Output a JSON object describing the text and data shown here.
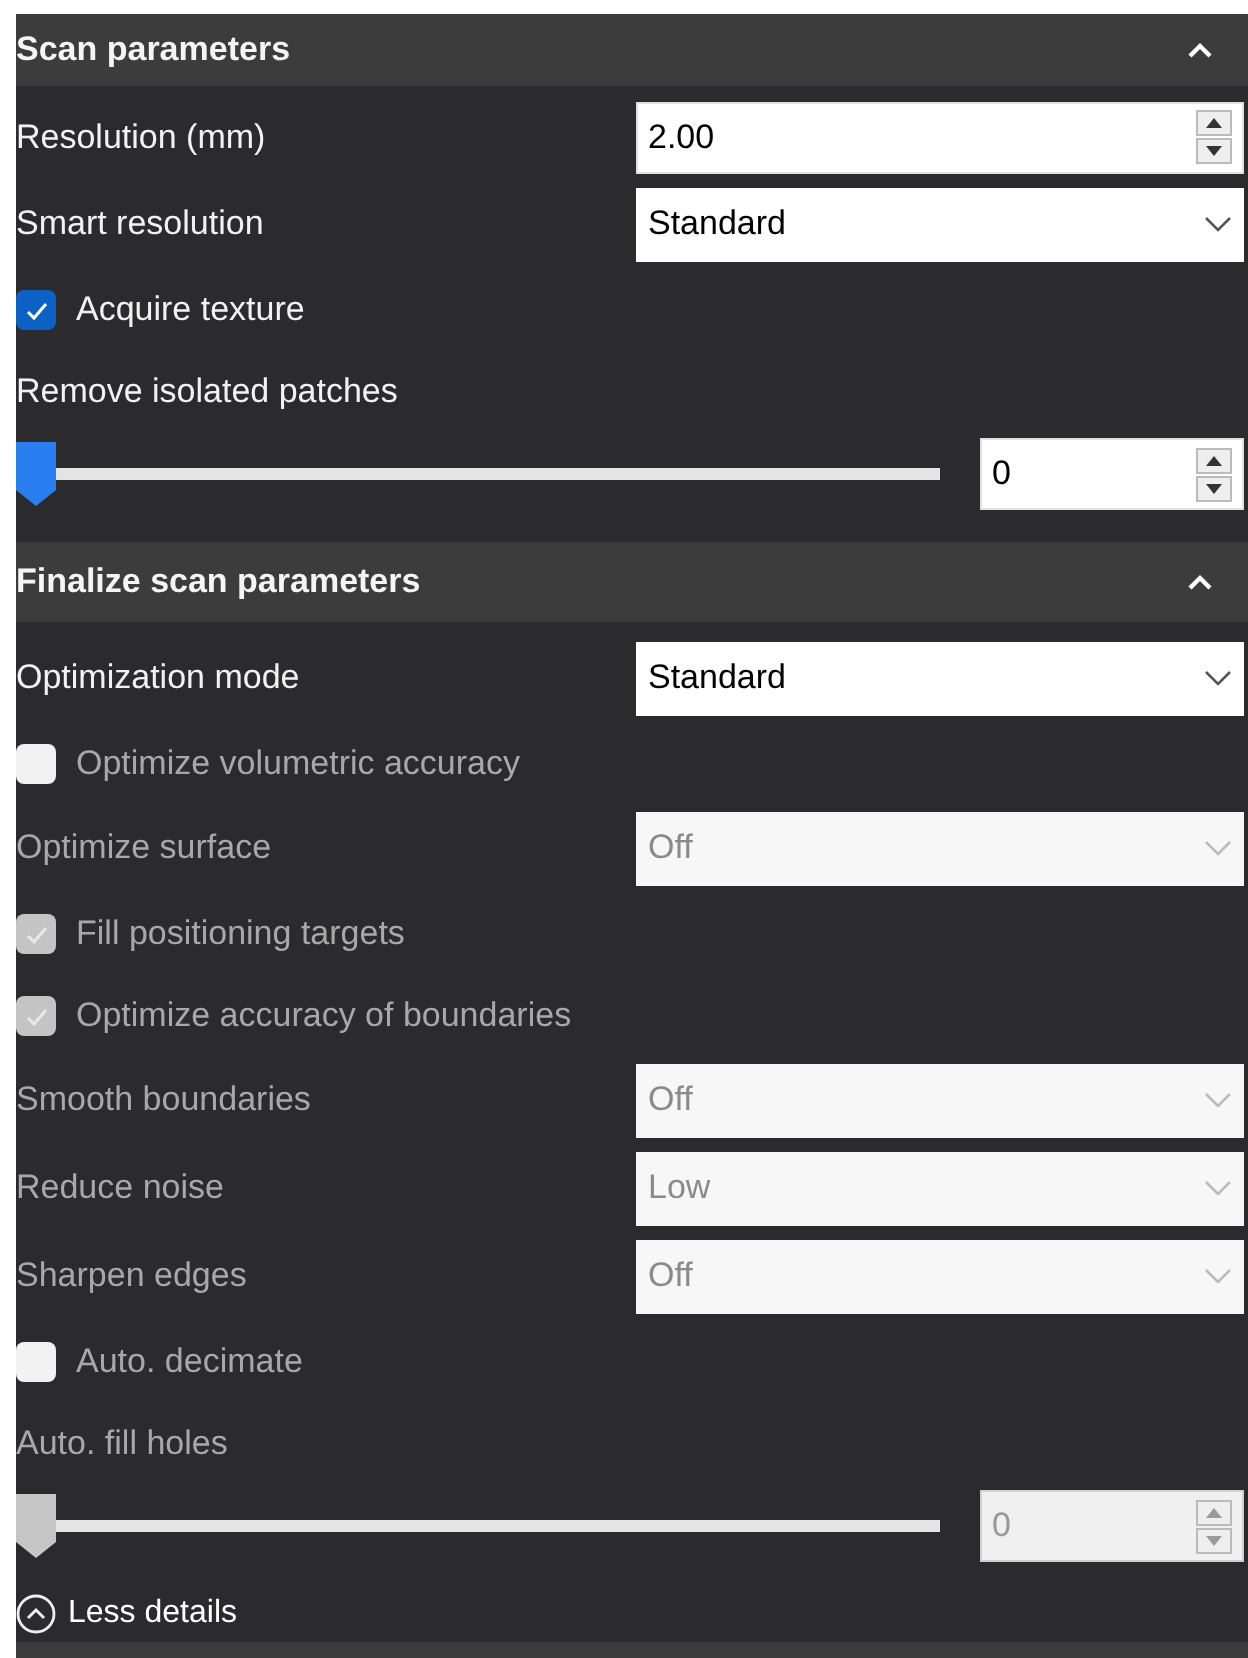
{
  "sections": [
    {
      "title": "Scan parameters",
      "expanded": true,
      "items": [
        {
          "kind": "spin",
          "label": "Resolution (mm)",
          "value": "2.00",
          "disabled": false
        },
        {
          "kind": "select",
          "label": "Smart resolution",
          "value": "Standard",
          "disabled": false
        },
        {
          "kind": "checkbox",
          "label": "Acquire texture",
          "checked": true,
          "disabled": false
        },
        {
          "kind": "slider",
          "label": "Remove isolated patches",
          "level": 0,
          "value": "0",
          "disabled": false
        }
      ]
    },
    {
      "title": "Finalize scan parameters",
      "expanded": true,
      "items": [
        {
          "kind": "select",
          "label": "Optimization mode",
          "value": "Standard",
          "disabled": false
        },
        {
          "kind": "checkbox",
          "label": "Optimize volumetric accuracy",
          "checked": false,
          "disabled": true
        },
        {
          "kind": "select",
          "label": "Optimize surface",
          "value": "Off",
          "disabled": true
        },
        {
          "kind": "checkbox",
          "label": "Fill positioning targets",
          "checked": true,
          "disabled": true
        },
        {
          "kind": "checkbox",
          "label": "Optimize accuracy of boundaries",
          "checked": true,
          "disabled": true
        },
        {
          "kind": "select",
          "label": "Smooth boundaries",
          "value": "Off",
          "disabled": true
        },
        {
          "kind": "select",
          "label": "Reduce noise",
          "value": "Low",
          "disabled": true
        },
        {
          "kind": "select",
          "label": "Sharpen edges",
          "value": "Off",
          "disabled": true
        },
        {
          "kind": "checkbox",
          "label": "Auto. decimate",
          "checked": false,
          "disabled": true
        },
        {
          "kind": "slider",
          "label": "Auto. fill holes",
          "level": 0,
          "value": "0",
          "disabled": true
        }
      ]
    }
  ],
  "footer": {
    "link": "Less details"
  }
}
